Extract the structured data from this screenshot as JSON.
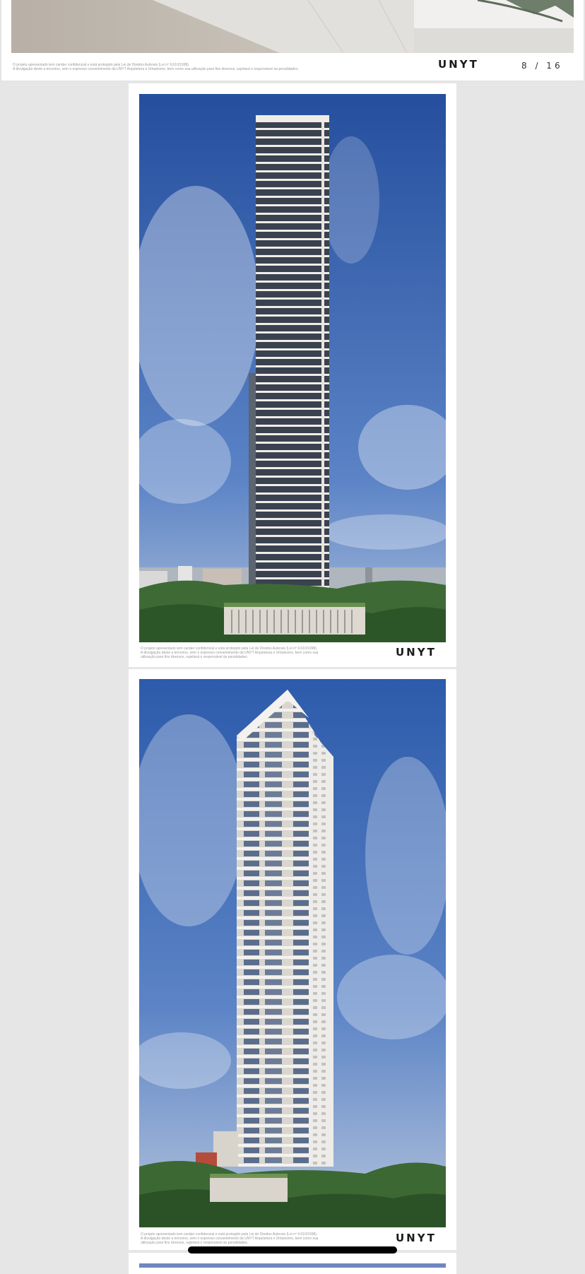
{
  "pages": [
    {
      "id": "page-8",
      "disclaimer_line1": "O projeto apresentado tem caráter confidencial e está protegido pela Lei de Direitos Autorais (Lei nº 9.610/1998).",
      "disclaimer_line2": "A divulgação deste a terceiros, sem o expresso consentimento da UNYT Arquitetura e Urbanismo, bem como sua utilização para fins diversos, sujeitará o responsável às penalidades.",
      "logo": "UNYT",
      "counter": "8 / 16"
    },
    {
      "id": "page-9",
      "disclaimer_line1": "O projeto apresentado tem caráter confidencial e está protegido pela Lei de Direitos Autorais (Lei nº 9.610/1998).",
      "disclaimer_line2": "A divulgação deste a terceiros, sem o expresso consentimento da UNYT Arquitetura e Urbanismo, bem como sua",
      "disclaimer_line3": "utilização para fins diversos, sujeitará o responsável às penalidades.",
      "logo": "UNYT"
    },
    {
      "id": "page-10",
      "disclaimer_line1": "O projeto apresentado tem caráter confidencial e está protegido pela Lei de Direitos Autorais (Lei nº 9.610/1998).",
      "disclaimer_line2": "A divulgação deste a terceiros, sem o expresso consentimento da UNYT Arquitetura e Urbanismo, bem como sua",
      "disclaimer_line3": "utilização para fins diversos, sujeitará o responsável às penalidades.",
      "logo": "UNYT"
    }
  ],
  "colors": {
    "background": "#e6e6e6",
    "sky": "#2f5fb3",
    "tower": "#efece6"
  }
}
